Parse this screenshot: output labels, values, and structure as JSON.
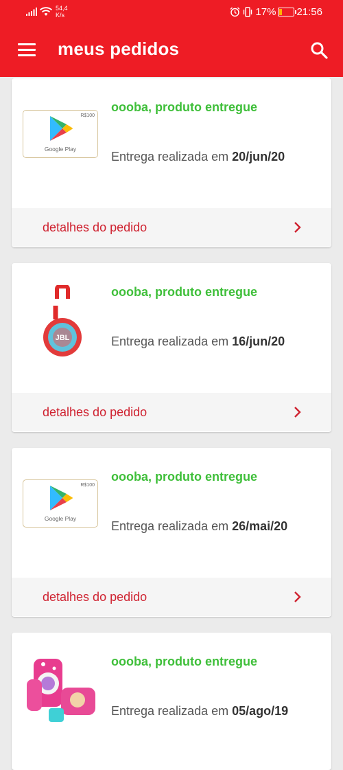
{
  "status_bar": {
    "net_speed": "54,4",
    "net_unit": "K/s",
    "battery": "17%",
    "battery_level": 0.17,
    "time": "21:56"
  },
  "header": {
    "title": "meus pedidos"
  },
  "orders": [
    {
      "status": "oooba, produto entregue",
      "delivery_prefix": "Entrega realizada em ",
      "delivery_date": "20/jun/20",
      "image": "google-play-gift-card",
      "card_amount": "R$100",
      "card_label": "Google Play",
      "details_label": "detalhes do pedido"
    },
    {
      "status": "oooba, produto entregue",
      "delivery_prefix": "Entrega realizada em ",
      "delivery_date": "16/jun/20",
      "image": "jbl-speaker",
      "speaker_brand": "JBL",
      "details_label": "detalhes do pedido"
    },
    {
      "status": "oooba, produto entregue",
      "delivery_prefix": "Entrega realizada em ",
      "delivery_date": "26/mai/20",
      "image": "google-play-gift-card",
      "card_amount": "R$100",
      "card_label": "Google Play",
      "details_label": "detalhes do pedido"
    },
    {
      "status": "oooba, produto entregue",
      "delivery_prefix": "Entrega realizada em ",
      "delivery_date": "05/ago/19",
      "image": "kids-backpack-kit"
    }
  ],
  "colors": {
    "brand_red": "#ee1c25",
    "status_green": "#3fbf3a",
    "link_red": "#cf2230"
  }
}
